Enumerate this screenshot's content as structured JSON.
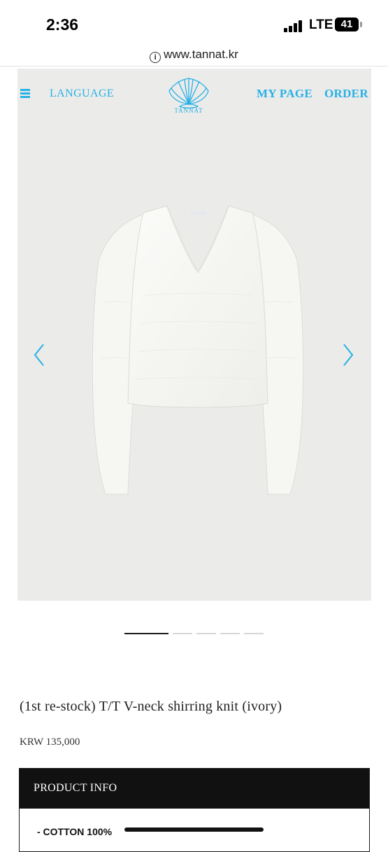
{
  "status_bar": {
    "time": "2:36",
    "network": "LTE",
    "battery": "41"
  },
  "browser": {
    "url": "www.tannat.kr",
    "icon": "info-icon"
  },
  "nav": {
    "menu_icon": "hamburger-icon",
    "language": "LANGUAGE",
    "logo_text": "TANNAT",
    "my_page": "MY PAGE",
    "order": "ORDER"
  },
  "gallery": {
    "image_alt": "ivory v-neck shirring knit",
    "prev_icon": "chevron-left-icon",
    "next_icon": "chevron-right-icon",
    "slide_count": 5,
    "active_slide": 1
  },
  "product": {
    "title": "(1st re-stock) T/T V-neck shirring knit (ivory)",
    "price": "KRW 135,000",
    "info_header": "PRODUCT INFO",
    "info_lines": [
      "- COTTON 100%"
    ]
  },
  "colors": {
    "accent": "#27b1e6",
    "hero_background": "#ebebea",
    "info_header_bg": "#111111"
  }
}
